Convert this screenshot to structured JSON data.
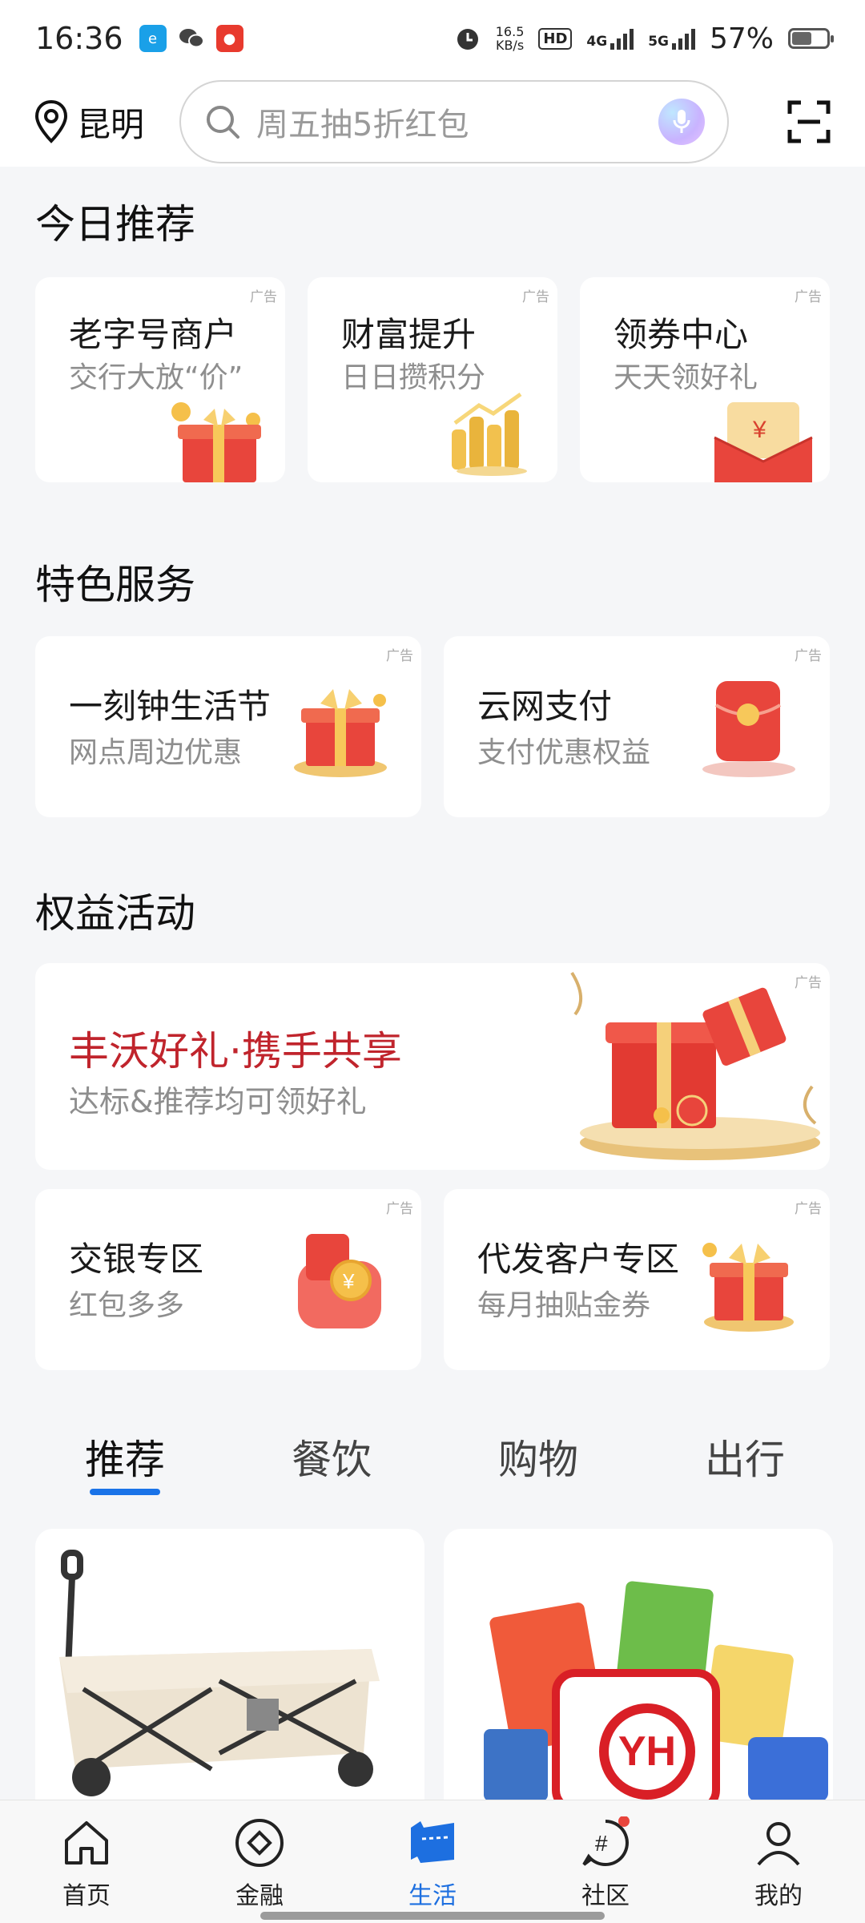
{
  "status_bar": {
    "time": "16:36",
    "speed_value": "16.5",
    "speed_unit": "KB/s",
    "hd_label": "HD",
    "net1": "4G",
    "net2": "5G",
    "battery": "57%",
    "battery_level": 0.57
  },
  "header": {
    "location": "昆明",
    "search_placeholder": "周五抽5折红包"
  },
  "today": {
    "title": "今日推荐",
    "cards": [
      {
        "title": "老字号商户",
        "sub": "交行大放“价”",
        "ad": "广告"
      },
      {
        "title": "财富提升",
        "sub": "日日攒积分",
        "ad": "广告"
      },
      {
        "title": "领券中心",
        "sub": "天天领好礼",
        "ad": "广告"
      }
    ]
  },
  "special": {
    "title": "特色服务",
    "cards": [
      {
        "title": "一刻钟生活节",
        "sub": "网点周边优惠",
        "ad": "广告"
      },
      {
        "title": "云网支付",
        "sub": "支付优惠权益",
        "ad": "广告"
      }
    ]
  },
  "benefits": {
    "title": "权益活动",
    "banner": {
      "title": "丰沃好礼·携手共享",
      "sub": "达标&推荐均可领好礼",
      "ad": "广告"
    },
    "cards": [
      {
        "title": "交银专区",
        "sub": "红包多多",
        "ad": "广告"
      },
      {
        "title": "代发客户专区",
        "sub": "每月抽贴金券",
        "ad": "广告"
      }
    ]
  },
  "tabs": [
    "推荐",
    "餐饮",
    "购物",
    "出行"
  ],
  "product_logo": "YH",
  "bottom_nav": [
    {
      "label": "首页",
      "icon": "home-icon"
    },
    {
      "label": "金融",
      "icon": "finance-icon"
    },
    {
      "label": "生活",
      "icon": "life-icon"
    },
    {
      "label": "社区",
      "icon": "community-icon"
    },
    {
      "label": "我的",
      "icon": "profile-icon"
    }
  ],
  "colors": {
    "accent": "#1d6fe0",
    "banner_title": "#c0242c"
  }
}
